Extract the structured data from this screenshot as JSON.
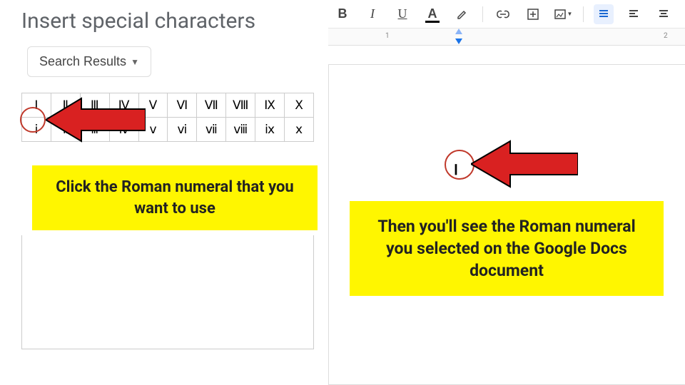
{
  "left": {
    "title": "Insert special characters",
    "search_label": "Search Results",
    "grid": {
      "row1": [
        "Ⅰ",
        "Ⅱ",
        "Ⅲ",
        "Ⅳ",
        "Ⅴ",
        "Ⅵ",
        "Ⅶ",
        "Ⅷ",
        "Ⅸ",
        "Ⅹ"
      ],
      "row2": [
        "ⅰ",
        "ⅱ",
        "ⅲ",
        "ⅳ",
        "ⅴ",
        "ⅵ",
        "ⅶ",
        "ⅷ",
        "ⅸ",
        "ⅹ"
      ]
    },
    "callout": "Click the Roman numeral that you want to use"
  },
  "right": {
    "toolbar": {
      "bold": "B",
      "italic": "I",
      "underline": "U",
      "text_color": "A",
      "highlight": "✎",
      "link": "⊂⊃",
      "insert_image": "⊞",
      "align": "≡"
    },
    "ruler": {
      "ticks": [
        "1",
        "2"
      ]
    },
    "inserted_char": "Ⅰ",
    "callout": "Then you'll see the Roman numeral you selected on the Google Docs document"
  }
}
